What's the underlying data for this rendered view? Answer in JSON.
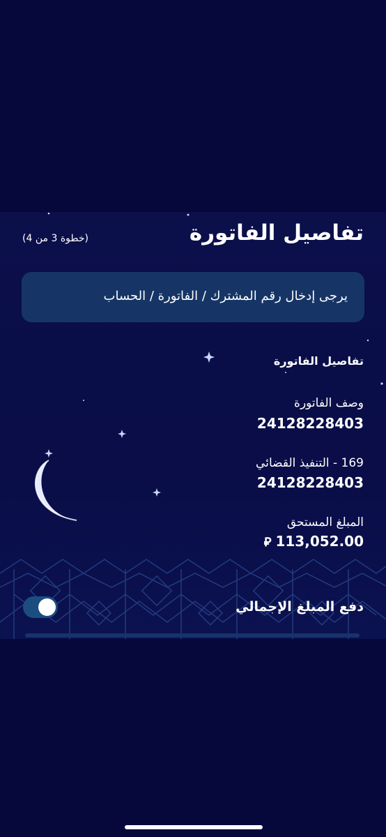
{
  "header": {
    "title": "تفاصيل الفاتورة",
    "step": "(خطوة 3 من 4)"
  },
  "info": {
    "message": "يرجى إدخال رقم المشترك / الفاتورة / الحساب"
  },
  "details": {
    "heading": "تفاصيل الفاتورة",
    "fields": [
      {
        "label": "وصف الفاتورة",
        "value": "24128228403"
      },
      {
        "label": "169 - التنفيذ القضائي",
        "value": "24128228403"
      },
      {
        "label": "المبلغ المستحق",
        "value": "113,052.00",
        "currency_symbol": "⃁"
      }
    ]
  },
  "pay_total": {
    "label": "دفع المبلغ الإجمالي",
    "enabled": true
  },
  "colors": {
    "background": "#07083a",
    "info_box": "#163566",
    "toggle_track": "#1b4d80"
  },
  "icons": {
    "moon": "crescent-moon-icon",
    "toggle": "toggle-switch"
  }
}
